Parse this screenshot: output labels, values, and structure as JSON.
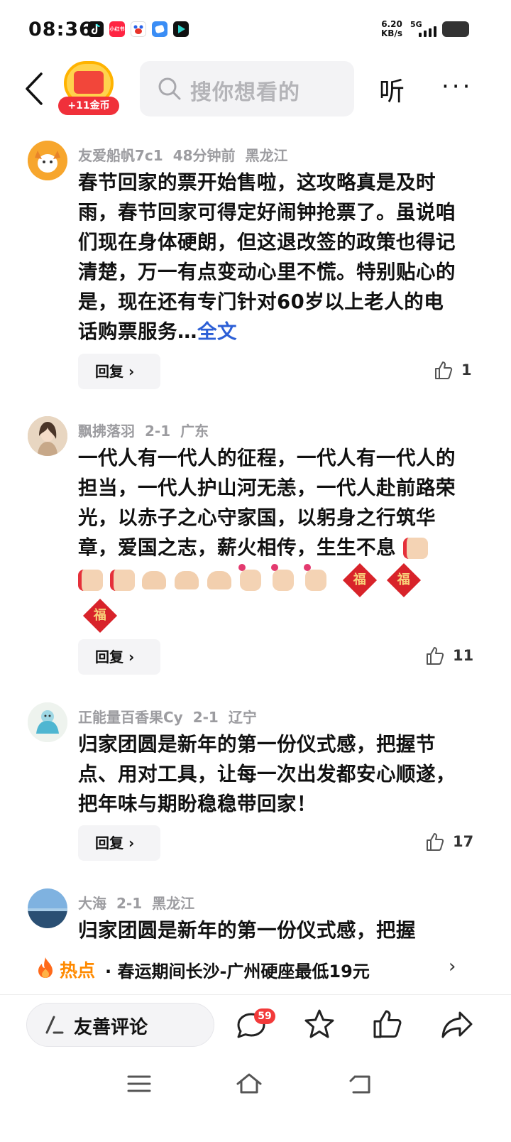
{
  "status_bar": {
    "time": "08:36",
    "net_speed_value": "6.20",
    "net_speed_unit": "KB/s",
    "net_type": "5G",
    "app_icons": [
      "tiktok-icon",
      "xiaohongshu-icon",
      "baidu-icon",
      "messaging-icon",
      "video-icon"
    ],
    "xiaohongshu_label": "小红书"
  },
  "header": {
    "coin_reward": "+11金币",
    "search_placeholder": "搜你想看的",
    "listen_label": "听",
    "more_label": "···"
  },
  "comments": [
    {
      "user": "友爱船帆7c1",
      "time": "48分钟前",
      "location": "黑龙江",
      "text": "春节回家的票开始售啦，这攻略真是及时雨，春节回家可得定好闹钟抢票了。虽说咱们现在身体硬朗，但这退改签的政策也得记清楚，万一有点变动心里不慌。特别贴心的是，现在还有专门针对60岁以上老人的电话购票服务…",
      "full_text_link": "全文",
      "reply_label": "回复",
      "likes": "1"
    },
    {
      "user": "飘拂落羽",
      "time": "2-1",
      "location": "广东",
      "text": "一代人有一代人的征程，一代人有一代人的担当，一代人护山河无恙，一代人赴前路荣光，以赤子之心守家国，以躬身之行筑华章，爱国之志，薪火相传，生生不息",
      "emoji_fu": "福",
      "reply_label": "回复",
      "likes": "11"
    },
    {
      "user": "正能量百香果Cy",
      "time": "2-1",
      "location": "辽宁",
      "text": "归家团圆是新年的第一份仪式感，把握节点、用对工具，让每一次出发都安心顺遂，把年味与期盼稳稳带回家！",
      "reply_label": "回复",
      "likes": "17"
    },
    {
      "user": "大海",
      "time": "2-1",
      "location": "黑龙江",
      "text": "归家团圆是新年的第一份仪式感，把握"
    }
  ],
  "hot_banner": {
    "label": "热点",
    "text": "· 春运期间长沙-广州硬座最低19元"
  },
  "bottom_bar": {
    "comment_label": "友善评论",
    "comment_count": "59"
  },
  "colors": {
    "link": "#2c5fd6",
    "hot": "#ff8a00",
    "badge": "#f23a3a",
    "meta": "#9c9ca0"
  }
}
